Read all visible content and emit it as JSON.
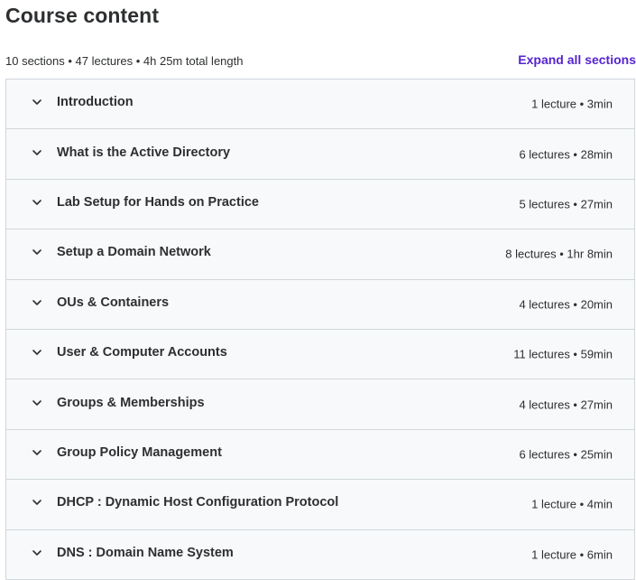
{
  "header": {
    "title": "Course content",
    "summary": "10 sections • 47 lectures • 4h 25m total length",
    "expand_all_label": "Expand all sections"
  },
  "icons": {
    "section_toggle": "chevron-down-icon"
  },
  "colors": {
    "accent": "#5624d0",
    "section_bg": "#f7f9fa",
    "border": "#d1d7dc",
    "text": "#2d2f31"
  },
  "sections": [
    {
      "title": "Introduction",
      "meta": "1 lecture • 3min"
    },
    {
      "title": "What is the Active Directory",
      "meta": "6 lectures • 28min"
    },
    {
      "title": "Lab Setup for Hands on Practice",
      "meta": "5 lectures • 27min"
    },
    {
      "title": "Setup a Domain Network",
      "meta": "8 lectures • 1hr 8min"
    },
    {
      "title": "OUs & Containers",
      "meta": "4 lectures • 20min"
    },
    {
      "title": "User & Computer Accounts",
      "meta": "11 lectures • 59min"
    },
    {
      "title": "Groups & Memberships",
      "meta": "4 lectures • 27min"
    },
    {
      "title": "Group Policy Management",
      "meta": "6 lectures • 25min"
    },
    {
      "title": "DHCP : Dynamic Host Configuration Protocol",
      "meta": "1 lecture • 4min"
    },
    {
      "title": "DNS : Domain Name System",
      "meta": "1 lecture • 6min"
    }
  ]
}
